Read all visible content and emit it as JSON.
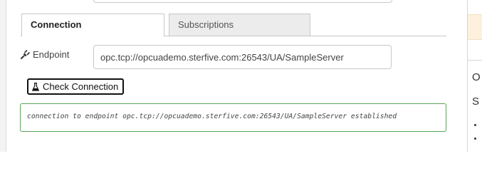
{
  "tabs": [
    {
      "label": "Connection",
      "active": true
    },
    {
      "label": "Subscriptions",
      "active": false
    }
  ],
  "endpoint": {
    "label": "Endpoint",
    "value": "opc.tcp://opcuademo.sterfive.com:26543/UA/SampleServer",
    "icon": "plug-icon"
  },
  "check_button": {
    "label": "Check Connection",
    "icon": "flask-icon"
  },
  "status": {
    "message": "connection to endpoint opc.tcp://opcuademo.sterfive.com:26543/UA/SampleServer established",
    "color": "#58a658"
  },
  "right_panel": {
    "letter_1": "O",
    "letter_2": "S"
  }
}
